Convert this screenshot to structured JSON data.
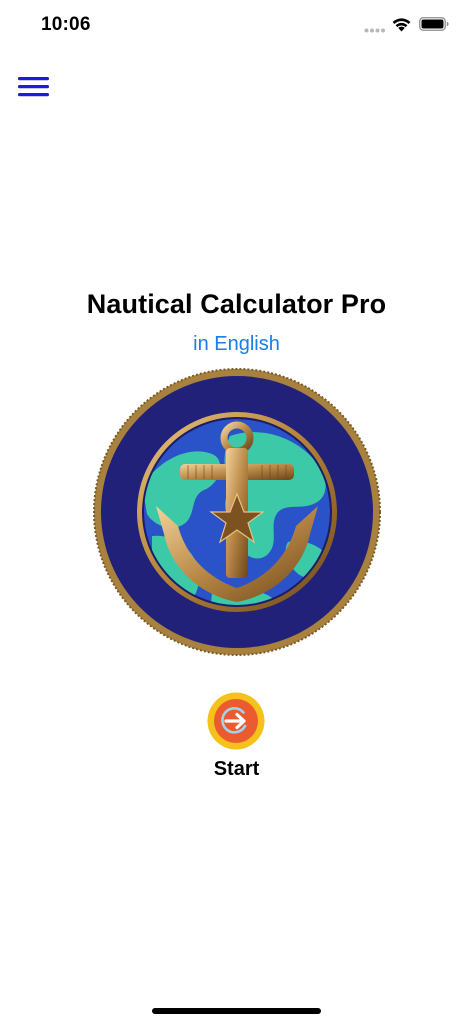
{
  "status_bar": {
    "time": "10:06"
  },
  "header": {
    "menu_icon": "hamburger-menu-icon"
  },
  "main": {
    "title": "Nautical Calculator Pro",
    "language_link": "in English",
    "emblem_icon": "anchor-globe-emblem",
    "start_icon": "arrow-right-circle-icon",
    "start_label": "Start"
  },
  "colors": {
    "accent_link": "#1a7ee6",
    "menu_icon": "#1c1cd6",
    "emblem_navy": "#21217a",
    "emblem_gold": "#a8813e",
    "globe_ocean": "#2a52c9",
    "globe_land": "#3cc9a8",
    "start_outer": "#f5c21b",
    "start_inner": "#ec5a2f"
  }
}
